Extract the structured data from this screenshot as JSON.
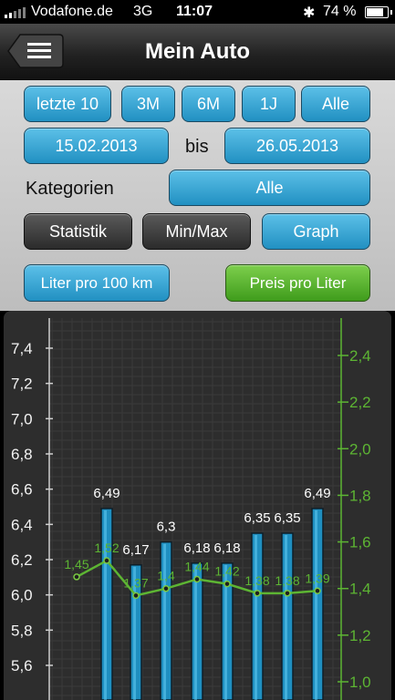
{
  "status_bar": {
    "carrier": "Vodafone.de",
    "network": "3G",
    "time": "11:07",
    "battery": "74 %",
    "battery_level": 0.74
  },
  "nav": {
    "title": "Mein Auto",
    "menu_icon": "menu-icon"
  },
  "filters": {
    "period_buttons": [
      "letzte 10",
      "3M",
      "6M",
      "1J",
      "Alle"
    ],
    "date_from": "15.02.2013",
    "date_separator": "bis",
    "date_to": "26.05.2013",
    "category_label": "Kategorien",
    "category_value": "Alle",
    "view_tabs": [
      "Statistik",
      "Min/Max",
      "Graph"
    ],
    "active_view": "Graph",
    "metric_left": "Liter pro 100 km",
    "metric_right": "Preis pro Liter"
  },
  "colors": {
    "accent_blue": "#2fa3d6",
    "accent_green": "#5db533",
    "series_green": "#7ac943"
  },
  "chart_data": {
    "type": "bar",
    "left_axis": {
      "ticks": [
        "5,6",
        "5,8",
        "6,0",
        "6,2",
        "6,4",
        "6,6",
        "6,8",
        "7,0",
        "7,2",
        "7,4"
      ],
      "range": [
        5.5,
        7.5
      ]
    },
    "right_axis": {
      "ticks": [
        "1,0",
        "1,2",
        "1,4",
        "1,6",
        "1,8",
        "2,0",
        "2,2",
        "2,4"
      ],
      "range": [
        1.0,
        2.45
      ]
    },
    "bars": {
      "values": [
        6.49,
        6.17,
        6.3,
        6.18,
        6.18,
        6.35,
        6.35,
        6.49
      ],
      "labels": [
        "6,49",
        "6,17",
        "6,3",
        "6,18",
        "6,18",
        "6,35",
        "6,35",
        "6,49"
      ]
    },
    "line": {
      "values": [
        1.45,
        1.52,
        1.37,
        1.4,
        1.44,
        1.42,
        1.38,
        1.38,
        1.39
      ],
      "labels": [
        "1,45",
        "1,52",
        "1,37",
        "1,4",
        "1,44",
        "1,42",
        "1,38",
        "1,38",
        "1,39"
      ]
    },
    "grid": true
  }
}
